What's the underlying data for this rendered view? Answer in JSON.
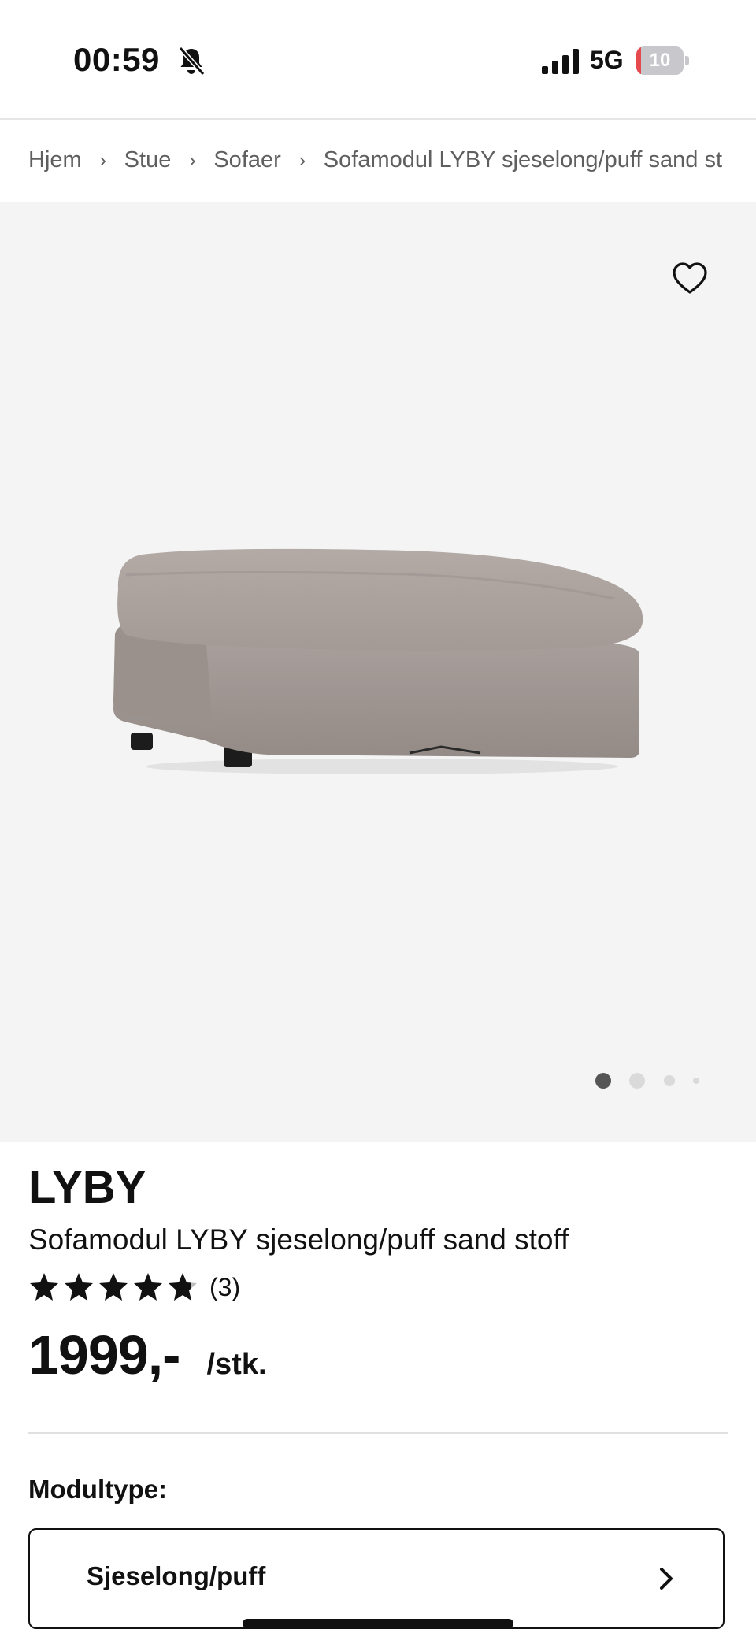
{
  "status_bar": {
    "time": "00:59",
    "network": "5G",
    "battery": "10",
    "battery_level": 0.1,
    "accent_color": "#e5484d"
  },
  "breadcrumb": [
    {
      "label": "Hjem"
    },
    {
      "label": "Stue"
    },
    {
      "label": "Sofaer"
    },
    {
      "label": "Sofamodul LYBY sjeselong/puff sand st"
    }
  ],
  "gallery": {
    "image_count": 4,
    "active_index": 0,
    "favorite_icon": "heart-icon"
  },
  "product": {
    "brand": "LYBY",
    "title": "Sofamodul LYBY sjeselong/puff sand stoff",
    "rating": 4.8,
    "review_count": "(3)",
    "price": "1999,-",
    "unit": "/stk."
  },
  "module": {
    "label": "Modultype:",
    "selected": "Sjeselong/puff"
  }
}
